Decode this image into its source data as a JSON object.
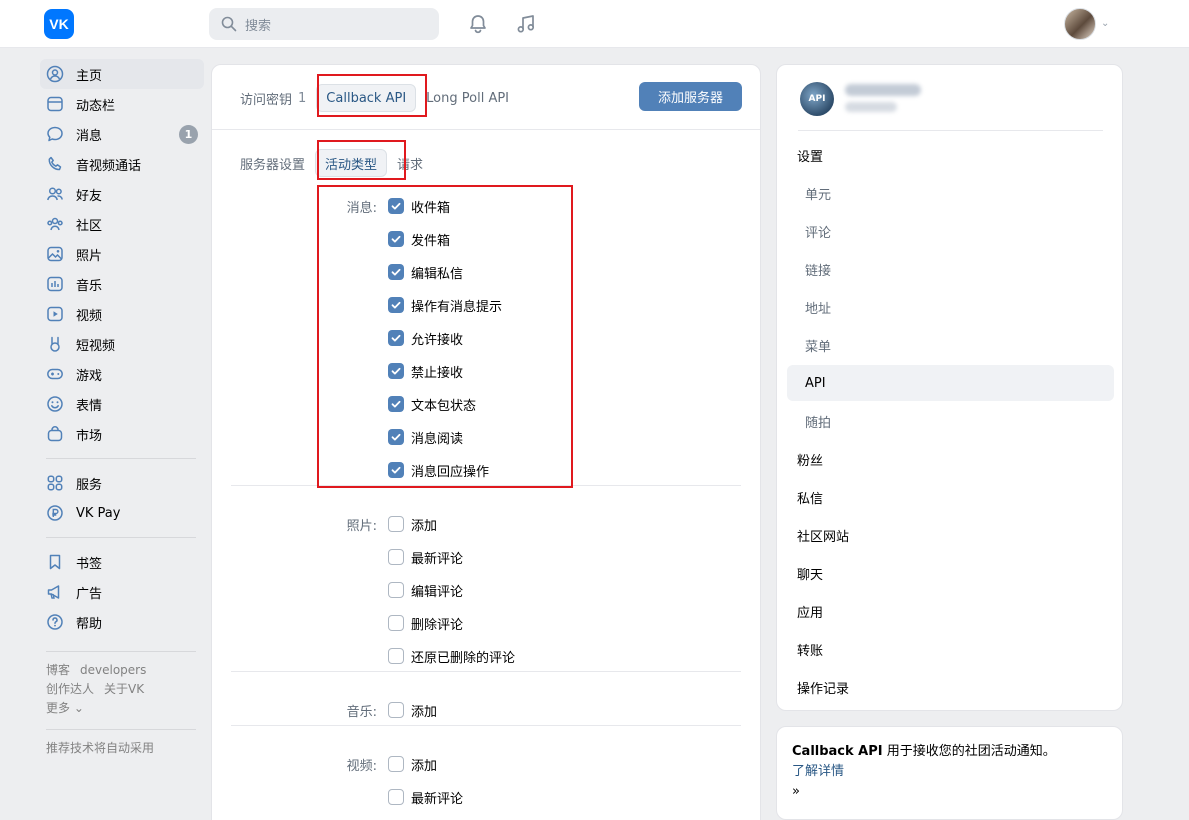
{
  "header": {
    "logo_text": "VK",
    "search_placeholder": "搜索"
  },
  "leftnav": {
    "items": [
      {
        "label": "主页",
        "icon": "user-circle-icon"
      },
      {
        "label": "动态栏",
        "icon": "newsfeed-icon"
      },
      {
        "label": "消息",
        "icon": "message-icon",
        "badge": "1"
      },
      {
        "label": "音视频通话",
        "icon": "phone-icon"
      },
      {
        "label": "好友",
        "icon": "friends-icon"
      },
      {
        "label": "社区",
        "icon": "community-icon"
      },
      {
        "label": "照片",
        "icon": "photo-icon"
      },
      {
        "label": "音乐",
        "icon": "music-icon"
      },
      {
        "label": "视频",
        "icon": "video-icon"
      },
      {
        "label": "短视频",
        "icon": "clips-icon"
      },
      {
        "label": "游戏",
        "icon": "gamepad-icon"
      },
      {
        "label": "表情",
        "icon": "smile-icon"
      },
      {
        "label": "市场",
        "icon": "market-icon"
      }
    ],
    "items2": [
      {
        "label": "服务",
        "icon": "services-icon"
      },
      {
        "label": "VK Pay",
        "icon": "vkpay-icon"
      }
    ],
    "items3": [
      {
        "label": "书签",
        "icon": "bookmark-icon"
      },
      {
        "label": "广告",
        "icon": "megaphone-icon"
      },
      {
        "label": "帮助",
        "icon": "help-icon"
      }
    ],
    "footer": {
      "blog": "博客",
      "developers": "developers",
      "creators": "创作达人",
      "about": "关于VK",
      "more": "更多 ⌄",
      "recommend": "推荐技术将自动采用"
    }
  },
  "center": {
    "tabs": {
      "access_keys": "访问密钥",
      "access_keys_count": "1",
      "callback_api": "Callback API",
      "long_poll": "Long Poll API"
    },
    "add_server": "添加服务器",
    "subtabs": {
      "server_settings": "服务器设置",
      "event_types": "活动类型",
      "requests": "请求"
    },
    "groups": [
      {
        "label": "消息:",
        "items": [
          {
            "label": "收件箱",
            "checked": true
          },
          {
            "label": "发件箱",
            "checked": true
          },
          {
            "label": "编辑私信",
            "checked": true
          },
          {
            "label": "操作有消息提示",
            "checked": true
          },
          {
            "label": "允许接收",
            "checked": true
          },
          {
            "label": "禁止接收",
            "checked": true
          },
          {
            "label": "文本包状态",
            "checked": true
          },
          {
            "label": "消息阅读",
            "checked": true
          },
          {
            "label": "消息回应操作",
            "checked": true
          }
        ]
      },
      {
        "label": "照片:",
        "items": [
          {
            "label": "添加",
            "checked": false
          },
          {
            "label": "最新评论",
            "checked": false
          },
          {
            "label": "编辑评论",
            "checked": false
          },
          {
            "label": "删除评论",
            "checked": false
          },
          {
            "label": "还原已删除的评论",
            "checked": false
          }
        ]
      },
      {
        "label": "音乐:",
        "items": [
          {
            "label": "添加",
            "checked": false
          }
        ]
      },
      {
        "label": "视频:",
        "items": [
          {
            "label": "添加",
            "checked": false
          },
          {
            "label": "最新评论",
            "checked": false
          }
        ]
      }
    ]
  },
  "right": {
    "avatar_text": "API",
    "menu": [
      {
        "label": "设置",
        "sub": false,
        "selected": false
      },
      {
        "label": "单元",
        "sub": true,
        "selected": false
      },
      {
        "label": "评论",
        "sub": true,
        "selected": false
      },
      {
        "label": "链接",
        "sub": true,
        "selected": false
      },
      {
        "label": "地址",
        "sub": true,
        "selected": false
      },
      {
        "label": "菜单",
        "sub": true,
        "selected": false
      },
      {
        "label": "API",
        "sub": true,
        "selected": true
      },
      {
        "label": "随拍",
        "sub": true,
        "selected": false
      },
      {
        "label": "粉丝",
        "sub": false,
        "selected": false
      },
      {
        "label": "私信",
        "sub": false,
        "selected": false
      },
      {
        "label": "社区网站",
        "sub": false,
        "selected": false
      },
      {
        "label": "聊天",
        "sub": false,
        "selected": false
      },
      {
        "label": "应用",
        "sub": false,
        "selected": false
      },
      {
        "label": "转账",
        "sub": false,
        "selected": false
      },
      {
        "label": "操作记录",
        "sub": false,
        "selected": false
      }
    ],
    "info": {
      "bold": "Callback API",
      "text": " 用于接收您的社团活动通知。",
      "link": "了解详情",
      "arrow": "»"
    }
  },
  "colors": {
    "accent": "#5181b8",
    "highlight_box": "#e0191e",
    "background": "#edeef0"
  }
}
